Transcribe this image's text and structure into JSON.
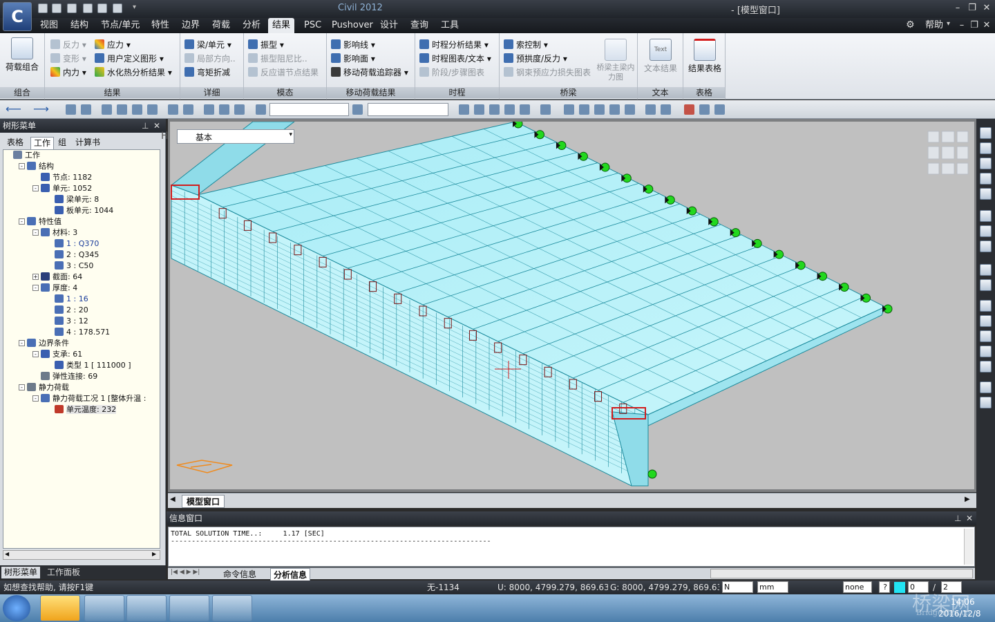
{
  "app": {
    "title": "Civil 2012",
    "document": "- [模型窗口]",
    "icon_label": "C"
  },
  "menu": {
    "tabs": [
      "视图",
      "结构",
      "节点/单元",
      "特性",
      "边界",
      "荷载",
      "分析",
      "结果",
      "PSC",
      "Pushover",
      "设计",
      "查询",
      "工具"
    ],
    "active": "结果",
    "help": "帮助"
  },
  "ribbon": {
    "groups": [
      {
        "label": "组合",
        "big": "荷载组合"
      },
      {
        "label": "结果",
        "items": [
          {
            "text": "反力",
            "disabled": true
          },
          {
            "text": "变形",
            "disabled": true
          },
          {
            "text": "内力",
            "disabled": false
          },
          {
            "text": "应力",
            "disabled": false
          },
          {
            "text": "用户定义图形",
            "disabled": false
          },
          {
            "text": "水化热分析结果",
            "disabled": false
          }
        ]
      },
      {
        "label": "详细",
        "items": [
          {
            "text": "梁/单元",
            "disabled": false
          },
          {
            "text": "局部方向..",
            "disabled": true
          },
          {
            "text": "弯矩折减",
            "disabled": false
          }
        ]
      },
      {
        "label": "模态",
        "items": [
          {
            "text": "振型",
            "disabled": false
          },
          {
            "text": "振型阻尼比..",
            "disabled": true
          },
          {
            "text": "反应谱节点结果",
            "disabled": true
          }
        ]
      },
      {
        "label": "移动荷载结果",
        "items": [
          {
            "text": "影响线",
            "disabled": false
          },
          {
            "text": "影响面",
            "disabled": false
          },
          {
            "text": "移动荷载追踪器",
            "disabled": false
          }
        ]
      },
      {
        "label": "时程",
        "items": [
          {
            "text": "时程分析结果",
            "disabled": false
          },
          {
            "text": "时程图表/文本",
            "disabled": false
          },
          {
            "text": "阶段/步骤图表",
            "disabled": true
          }
        ]
      },
      {
        "label": "桥梁",
        "items": [
          {
            "text": "索控制",
            "disabled": false
          },
          {
            "text": "预拱度/反力",
            "disabled": false
          },
          {
            "text": "钢束预应力损失图表",
            "disabled": true
          }
        ],
        "big1": "桥梁主梁内力图"
      },
      {
        "label": "文本",
        "big": "文本结果",
        "icon_text": "Text"
      },
      {
        "label": "表格",
        "big": "结果表格"
      }
    ]
  },
  "tree_panel": {
    "title": "树形菜单",
    "tabs": [
      "表格",
      "工作",
      "组",
      "计算书"
    ],
    "active_tab": "工作",
    "nodes": [
      {
        "text": "工作",
        "level": 0,
        "exp": "",
        "color": "#6b7fa0"
      },
      {
        "text": "结构",
        "level": 1,
        "exp": "-",
        "color": "#4a6fb5"
      },
      {
        "text": "节点: 1182",
        "level": 2,
        "exp": "",
        "color": "#3a5fb0"
      },
      {
        "text": "单元: 1052",
        "level": 2,
        "exp": "-",
        "color": "#3a5fb0"
      },
      {
        "text": "梁单元: 8",
        "level": 3,
        "exp": "",
        "color": "#3a5fb0"
      },
      {
        "text": "板单元: 1044",
        "level": 3,
        "exp": "",
        "color": "#3a5fb0"
      },
      {
        "text": "特性值",
        "level": 1,
        "exp": "-",
        "color": "#4a6fb5"
      },
      {
        "text": "材料: 3",
        "level": 2,
        "exp": "-",
        "color": "#4a6fb5"
      },
      {
        "text": "1 : Q370",
        "level": 3,
        "exp": "",
        "color": "#4a6fb5",
        "tc": "#1a3c9a"
      },
      {
        "text": "2 : Q345",
        "level": 3,
        "exp": "",
        "color": "#4a6fb5"
      },
      {
        "text": "3 : C50",
        "level": 3,
        "exp": "",
        "color": "#4a6fb5"
      },
      {
        "text": "截面: 64",
        "level": 2,
        "exp": "+",
        "color": "#2b3f7a"
      },
      {
        "text": "厚度: 4",
        "level": 2,
        "exp": "-",
        "color": "#4a6fb5"
      },
      {
        "text": "1 : 16",
        "level": 3,
        "exp": "",
        "color": "#4a6fb5",
        "tc": "#1a3c9a"
      },
      {
        "text": "2 : 20",
        "level": 3,
        "exp": "",
        "color": "#4a6fb5"
      },
      {
        "text": "3 : 12",
        "level": 3,
        "exp": "",
        "color": "#4a6fb5"
      },
      {
        "text": "4 : 178.571",
        "level": 3,
        "exp": "",
        "color": "#4a6fb5"
      },
      {
        "text": "边界条件",
        "level": 1,
        "exp": "-",
        "color": "#4a6fb5"
      },
      {
        "text": "支承: 61",
        "level": 2,
        "exp": "-",
        "color": "#3a5fb0"
      },
      {
        "text": "类型 1 [ 111000 ]",
        "level": 3,
        "exp": "",
        "color": "#3a5fb0"
      },
      {
        "text": "弹性连接: 69",
        "level": 2,
        "exp": "",
        "color": "#6d7a8a"
      },
      {
        "text": "静力荷载",
        "level": 1,
        "exp": "-",
        "color": "#6d7a8a"
      },
      {
        "text": "静力荷载工况 1 [整体升温 :",
        "level": 2,
        "exp": "-",
        "color": "#4a6fb5"
      },
      {
        "text": "单元温度: 232",
        "level": 3,
        "exp": "",
        "color": "#c03a2a",
        "hl": true
      }
    ],
    "bottom_tabs": [
      "树形菜单",
      "工作面板"
    ],
    "bottom_active": "树形菜单"
  },
  "view": {
    "select_value": "基本",
    "tabs": [
      "模型窗口"
    ]
  },
  "info": {
    "title": "信息窗口",
    "lines": [
      "TOTAL SOLUTION TIME..:     1.17 [SEC]",
      "-----------------------------------------------------------------------------"
    ],
    "tabs": [
      "命令信息",
      "分析信息"
    ],
    "active_tab": "分析信息"
  },
  "status": {
    "help": "如想查找帮助, 请按F1键",
    "node": "无-1134",
    "ucs": "U: 8000, 4799.279, 869.633",
    "gcs": "G: 8000, 4799.279, 869.633",
    "force_unit": "N",
    "length_unit": "mm",
    "combo": "none",
    "page_a": "0",
    "page_sep": "/",
    "page_b": "2"
  },
  "taskbar": {
    "time": "14:06",
    "date": "2016/12/8",
    "watermark": "桥梁网",
    "watermark_url": "Bridgeman.cn"
  },
  "colors": {
    "deck": "#bdf3fb",
    "mesh": "#1a8a9c",
    "support": "#22d81e",
    "accent": "#d21c1c"
  }
}
